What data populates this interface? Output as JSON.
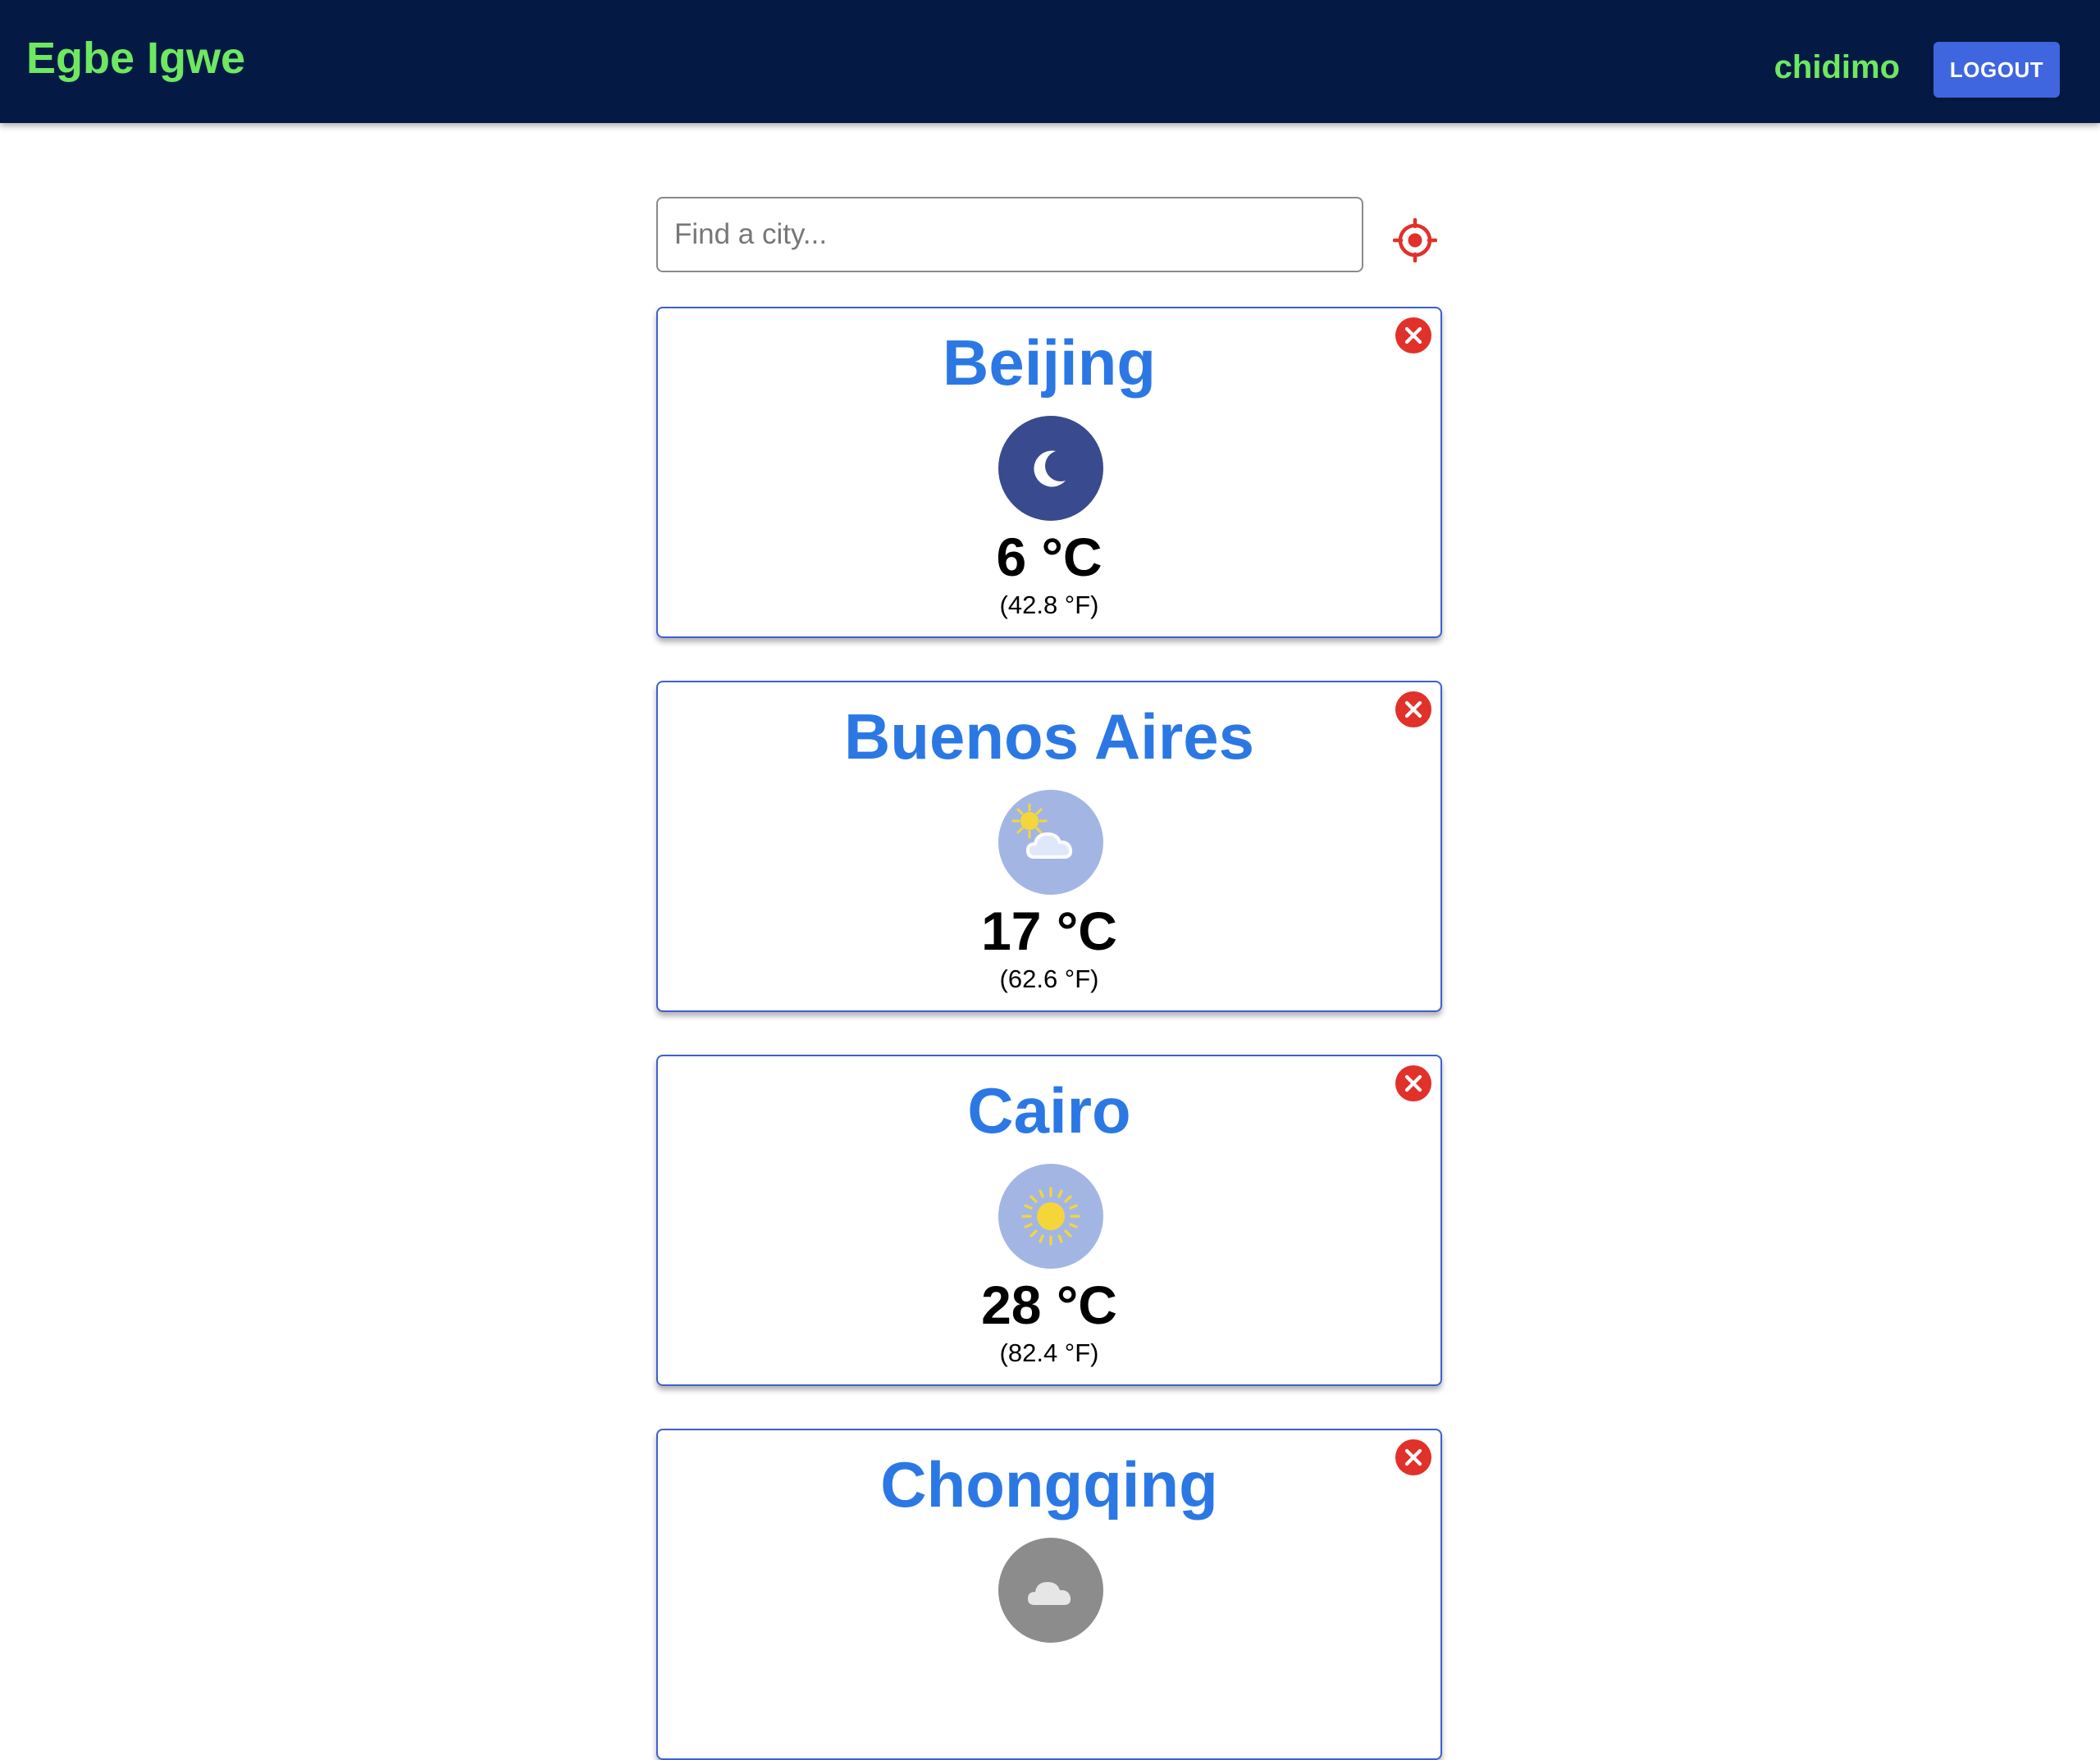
{
  "header": {
    "brand": "Egbe Igwe",
    "username": "chidimo",
    "logout_label": "LOGOUT",
    "bg_color": "#041a45",
    "accent_color": "#6ee860"
  },
  "search": {
    "placeholder": "Find a city...",
    "value": "",
    "locate_icon": "crosshair-icon"
  },
  "cities": [
    {
      "name": "Beijing",
      "icon": "moon-icon",
      "icon_bg": "#3a4a8e",
      "temp_c": "6 °C",
      "temp_f": "(42.8 °F)"
    },
    {
      "name": "Buenos Aires",
      "icon": "partly-cloudy-icon",
      "icon_bg": "#a3b6e3",
      "temp_c": "17 °C",
      "temp_f": "(62.6 °F)"
    },
    {
      "name": "Cairo",
      "icon": "sun-icon",
      "icon_bg": "#a3b6e3",
      "temp_c": "28 °C",
      "temp_f": "(82.4 °F)"
    },
    {
      "name": "Chongqing",
      "icon": "cloud-icon",
      "icon_bg": "#8c8c8c",
      "temp_c": "",
      "temp_f": ""
    }
  ],
  "colors": {
    "city_name": "#2b78e4",
    "close_button": "#e0312b",
    "card_border": "#3f5fd0"
  }
}
